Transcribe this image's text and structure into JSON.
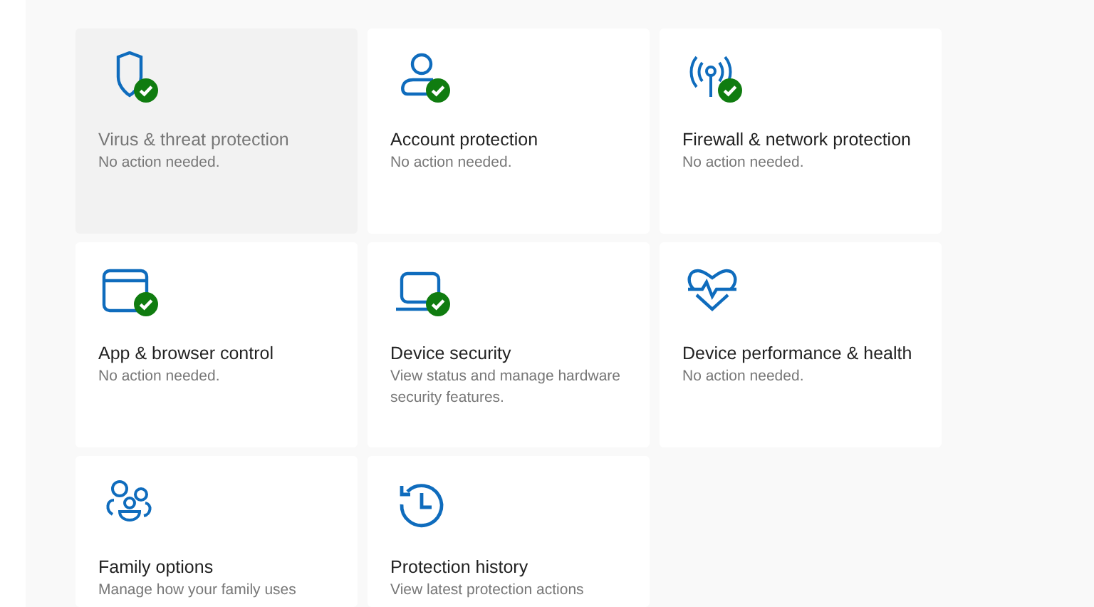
{
  "tiles": [
    {
      "kind": "shield",
      "title": "Virus & threat protection",
      "description": "No action needed.",
      "ok_badge": true,
      "selected": true
    },
    {
      "kind": "person",
      "title": "Account protection",
      "description": "No action needed.",
      "ok_badge": true,
      "selected": false
    },
    {
      "kind": "antenna",
      "title": "Firewall & network protection",
      "description": "No action needed.",
      "ok_badge": true,
      "selected": false
    },
    {
      "kind": "window",
      "title": "App & browser control",
      "description": "No action needed.",
      "ok_badge": true,
      "selected": false
    },
    {
      "kind": "laptop",
      "title": "Device security",
      "description": "View status and manage hardware security features.",
      "ok_badge": true,
      "selected": false
    },
    {
      "kind": "heart",
      "title": "Device performance & health",
      "description": "No action needed.",
      "ok_badge": false,
      "selected": false
    },
    {
      "kind": "family",
      "title": "Family options",
      "description": "Manage how your family uses",
      "ok_badge": false,
      "selected": false
    },
    {
      "kind": "history",
      "title": "Protection history",
      "description": "View latest protection actions",
      "ok_badge": false,
      "selected": false
    }
  ]
}
